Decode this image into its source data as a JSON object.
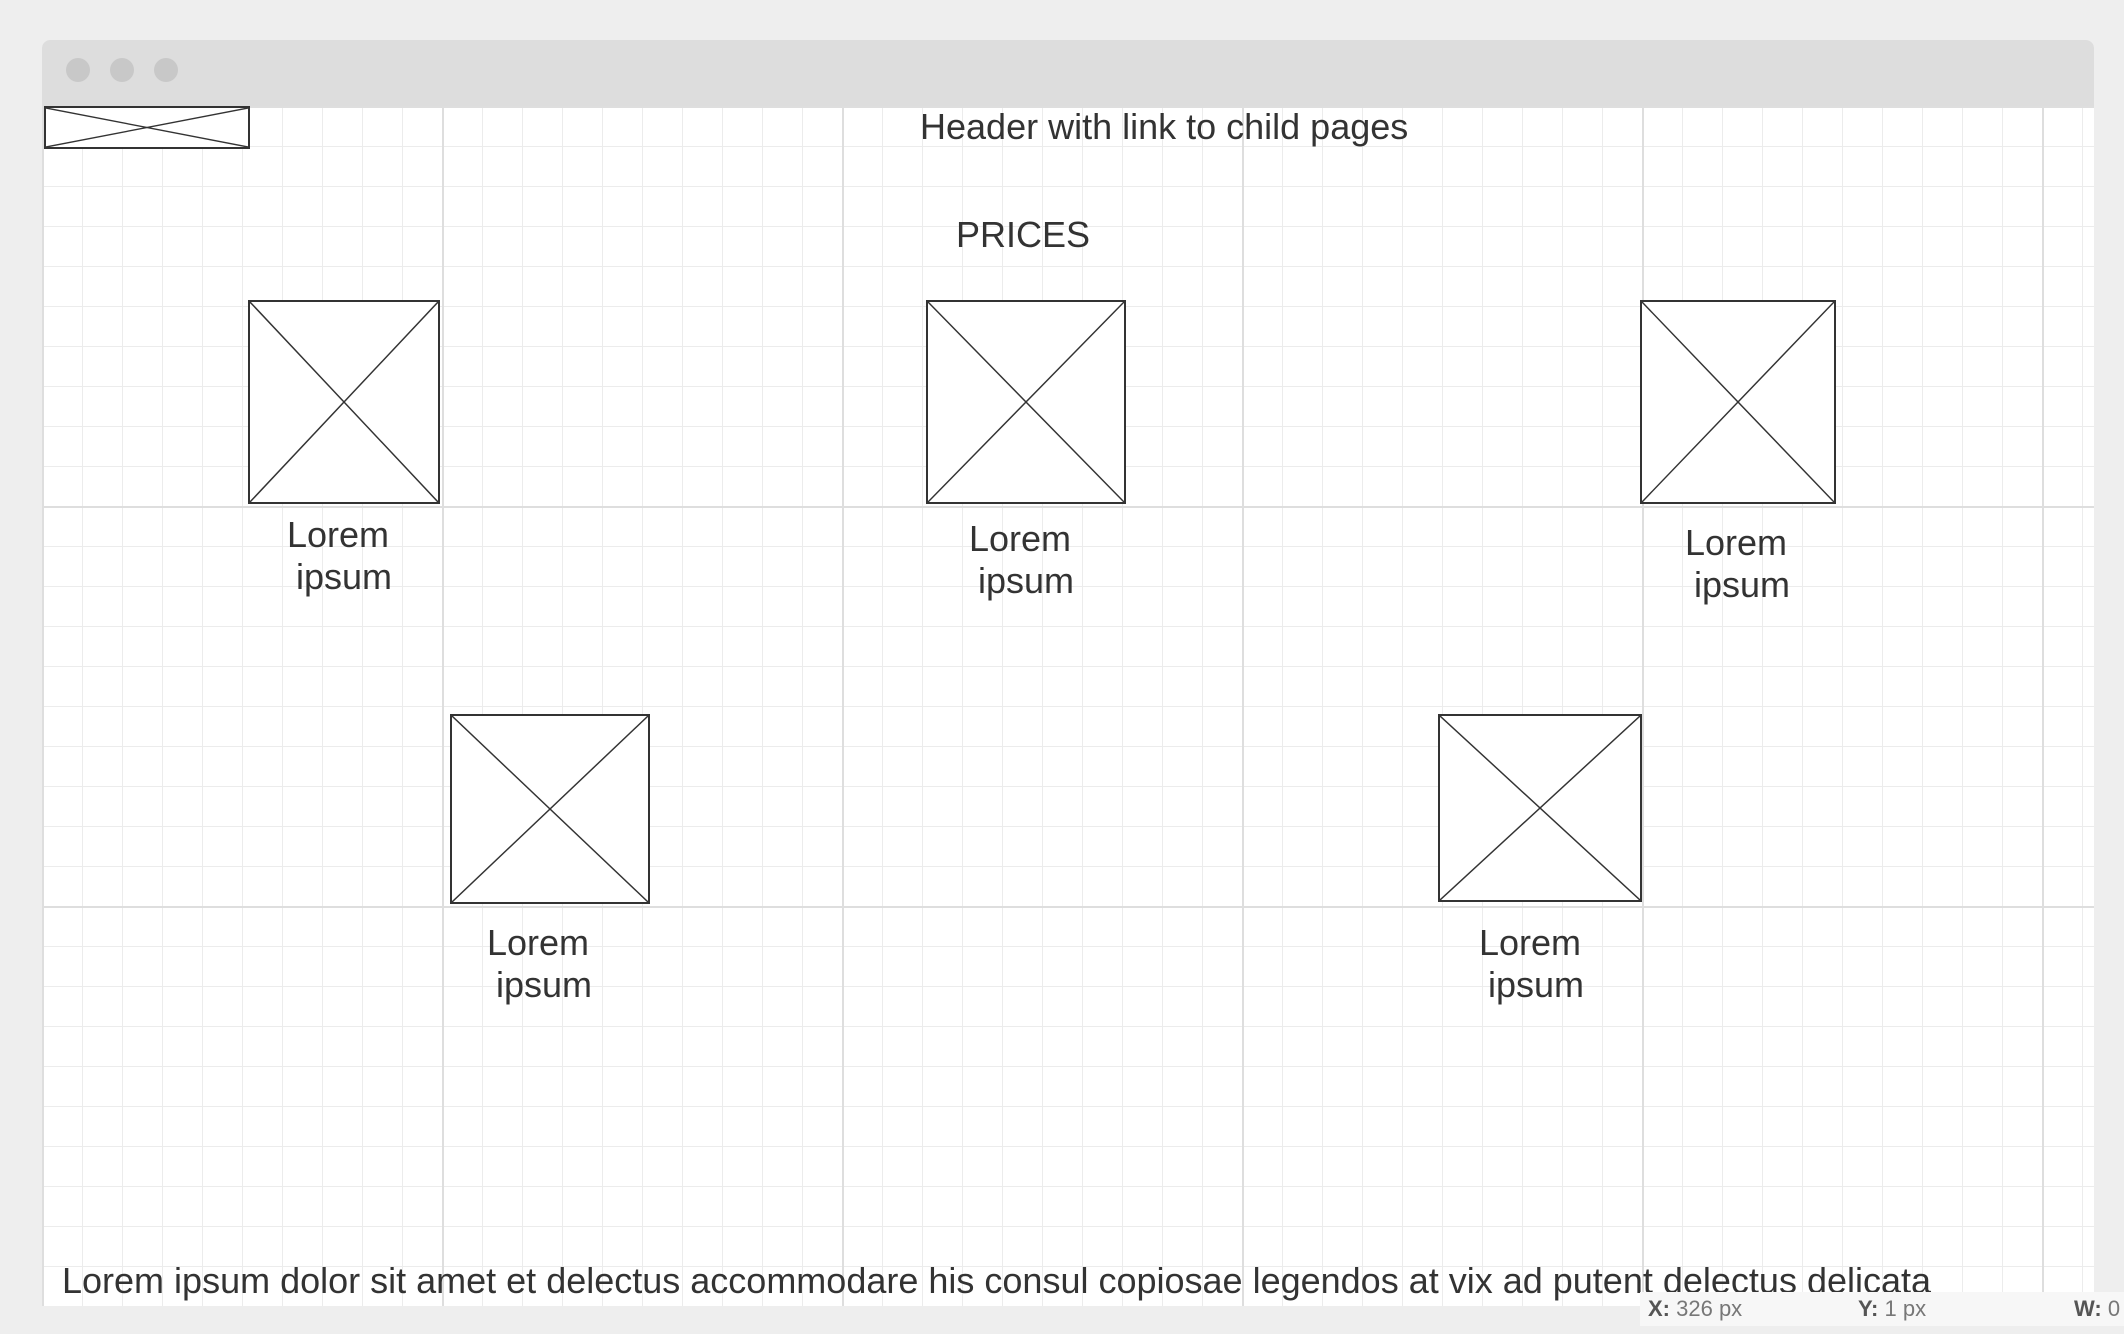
{
  "window": {
    "controls": [
      "close",
      "minimize",
      "maximize"
    ]
  },
  "header": {
    "logo_icon": "image-placeholder-icon",
    "text": "Header with link to child pages"
  },
  "section": {
    "title": "PRICES"
  },
  "cards": [
    {
      "line1": "Lorem",
      "line2": "ipsum",
      "icon": "image-placeholder-icon"
    },
    {
      "line1": "Lorem",
      "line2": "ipsum",
      "icon": "image-placeholder-icon"
    },
    {
      "line1": "Lorem",
      "line2": "ipsum",
      "icon": "image-placeholder-icon"
    },
    {
      "line1": "Lorem",
      "line2": "ipsum",
      "icon": "image-placeholder-icon"
    },
    {
      "line1": "Lorem",
      "line2": "ipsum",
      "icon": "image-placeholder-icon"
    }
  ],
  "footer": {
    "text": "Lorem ipsum dolor sit amet et delectus accommodare his consul copiosae legendos at vix ad putent delectus delicata"
  },
  "status_bar": {
    "x_label": "X:",
    "x_value": "326 px",
    "y_label": "Y:",
    "y_value": "1 px",
    "w_label": "W:",
    "w_value": "0"
  },
  "colors": {
    "stroke": "#333333",
    "grid_major": "#dedede",
    "grid_minor": "#ececec",
    "titlebar": "#dddddd"
  }
}
